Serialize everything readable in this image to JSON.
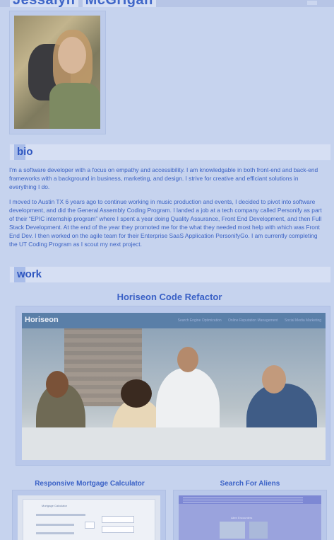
{
  "header": {
    "name_first": "Jessalyn",
    "name_last": "McGrigan"
  },
  "bio": {
    "heading": "bio",
    "paragraphs": [
      "I'm a software developer with a focus on empathy and accessibility. I am knowledgable in both front-end and back-end frameworks with a background in business, marketing, and design. I strive for creative and efficiant solutions in everything I do.",
      "I moved to Austin TX 6 years ago to continue working in music production and events, I decided to pivot into software development, and did the General Assembly Coding Program. I landed a job at a tech company called Personify as part of their “EPIC internship program” where I spent a year doing Quality Assurance, Front End Development, and then Full Stack Development. At the end of the year they promoted me for the what they needed most help with which was Front End Dev. I then worked on the agile team for their Enterprise SaaS Application PersonifyGo. I am currently completing the UT Coding Program as I scout my next project."
    ]
  },
  "work": {
    "heading": "work",
    "projects": [
      {
        "title": "Horiseon Code Refactor",
        "screenshot_logo": "Horiseon",
        "screenshot_nav": [
          "Search Engine Optimization",
          "Online Reputation Management",
          "Social Media Marketing"
        ]
      },
      {
        "title": "Responsive Mortgage Calculator",
        "screenshot_heading": "Mortgage Calculator"
      },
      {
        "title": "Search For Aliens",
        "screenshot_heading": "Alien Encounters"
      }
    ]
  },
  "colors": {
    "page_bg": "#c6d3ee",
    "accent": "#3c63c4",
    "heading_bar": "#d6dff3"
  }
}
